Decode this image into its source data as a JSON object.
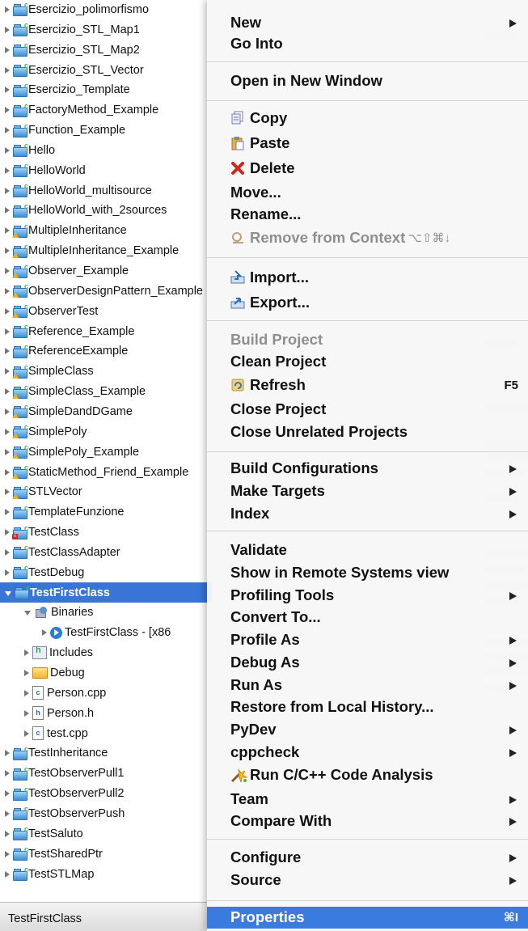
{
  "tree": {
    "items": [
      {
        "label": "Esercizio_polimorfismo",
        "badge": "c"
      },
      {
        "label": "Esercizio_STL_Map1",
        "badge": "c"
      },
      {
        "label": "Esercizio_STL_Map2",
        "badge": "c"
      },
      {
        "label": "Esercizio_STL_Vector",
        "badge": "c"
      },
      {
        "label": "Esercizio_Template",
        "badge": "c"
      },
      {
        "label": "FactoryMethod_Example",
        "badge": "c"
      },
      {
        "label": "Function_Example",
        "badge": "c"
      },
      {
        "label": "Hello",
        "badge": "c"
      },
      {
        "label": "HelloWorld",
        "badge": "c"
      },
      {
        "label": "HelloWorld_multisource",
        "badge": "c"
      },
      {
        "label": "HelloWorld_with_2sources",
        "badge": "c"
      },
      {
        "label": "MultipleInheritance",
        "badge": "warn"
      },
      {
        "label": "MultipleInheritance_Example",
        "badge": "warn"
      },
      {
        "label": "Observer_Example",
        "badge": "warn"
      },
      {
        "label": "ObserverDesignPattern_Example",
        "badge": "warn"
      },
      {
        "label": "ObserverTest",
        "badge": "warn"
      },
      {
        "label": "Reference_Example",
        "badge": "c"
      },
      {
        "label": "ReferenceExample",
        "badge": "c"
      },
      {
        "label": "SimpleClass",
        "badge": "warn"
      },
      {
        "label": "SimpleClass_Example",
        "badge": "warn"
      },
      {
        "label": "SimpleDandDGame",
        "badge": "warn"
      },
      {
        "label": "SimplePoly",
        "badge": "warn"
      },
      {
        "label": "SimplePoly_Example",
        "badge": "warn"
      },
      {
        "label": "StaticMethod_Friend_Example",
        "badge": "warn"
      },
      {
        "label": "STLVector",
        "badge": "warn"
      },
      {
        "label": "TemplateFunzione",
        "badge": "c"
      },
      {
        "label": "TestClass",
        "badge": "err"
      },
      {
        "label": "TestClassAdapter",
        "badge": "c"
      },
      {
        "label": "TestDebug",
        "badge": "c"
      },
      {
        "label": "TestFirstClass",
        "badge": "c",
        "selected": true
      }
    ],
    "children": {
      "binaries": "Binaries",
      "binary_item": "TestFirstClass - [x86",
      "includes": "Includes",
      "debug": "Debug",
      "files": [
        {
          "label": "Person.cpp",
          "glyph": "c"
        },
        {
          "label": "Person.h",
          "glyph": "h"
        },
        {
          "label": "test.cpp",
          "glyph": "c"
        }
      ]
    },
    "items_after": [
      {
        "label": "TestInheritance",
        "badge": "c"
      },
      {
        "label": "TestObserverPull1",
        "badge": "c"
      },
      {
        "label": "TestObserverPull2",
        "badge": "c"
      },
      {
        "label": "TestObserverPush",
        "badge": "c"
      },
      {
        "label": "TestSaluto",
        "badge": "c"
      },
      {
        "label": "TestSharedPtr",
        "badge": "c"
      },
      {
        "label": "TestSTLMap",
        "badge": "c"
      }
    ],
    "status": "TestFirstClass"
  },
  "menu": {
    "groups": [
      [
        {
          "label": "New",
          "submenu": true
        },
        {
          "label": "Go Into"
        }
      ],
      [
        {
          "label": "Open in New Window"
        }
      ],
      [
        {
          "label": "Copy",
          "icon": "copy-icon"
        },
        {
          "label": "Paste",
          "icon": "paste-icon"
        },
        {
          "label": "Delete",
          "icon": "delete-icon"
        },
        {
          "label": "Move..."
        },
        {
          "label": "Rename..."
        },
        {
          "label": "Remove from Context",
          "icon": "remove-context-icon",
          "disabled": true,
          "shortcut": "⌥⇧⌘↓"
        }
      ],
      [
        {
          "label": "Import...",
          "icon": "import-icon"
        },
        {
          "label": "Export...",
          "icon": "export-icon"
        }
      ],
      [
        {
          "label": "Build Project",
          "disabled": true
        },
        {
          "label": "Clean Project"
        },
        {
          "label": "Refresh",
          "icon": "refresh-icon",
          "shortcut": "F5"
        },
        {
          "label": "Close Project"
        },
        {
          "label": "Close Unrelated Projects"
        }
      ],
      [
        {
          "label": "Build Configurations",
          "submenu": true
        },
        {
          "label": "Make Targets",
          "submenu": true
        },
        {
          "label": "Index",
          "submenu": true
        }
      ],
      [
        {
          "label": "Validate"
        },
        {
          "label": "Show in Remote Systems view"
        },
        {
          "label": "Profiling Tools",
          "submenu": true
        },
        {
          "label": "Convert To..."
        },
        {
          "label": "Profile As",
          "submenu": true
        },
        {
          "label": "Debug As",
          "submenu": true
        },
        {
          "label": "Run As",
          "submenu": true
        },
        {
          "label": "Restore from Local History..."
        },
        {
          "label": "PyDev",
          "submenu": true
        },
        {
          "label": "cppcheck",
          "submenu": true
        },
        {
          "label": "Run C/C++ Code Analysis",
          "icon": "code-analysis-icon"
        },
        {
          "label": "Team",
          "submenu": true
        },
        {
          "label": "Compare With",
          "submenu": true
        }
      ],
      [
        {
          "label": "Configure",
          "submenu": true
        },
        {
          "label": "Source",
          "submenu": true
        }
      ],
      [
        {
          "label": "Properties",
          "shortcut": "⌘I",
          "selected": true
        }
      ]
    ]
  }
}
